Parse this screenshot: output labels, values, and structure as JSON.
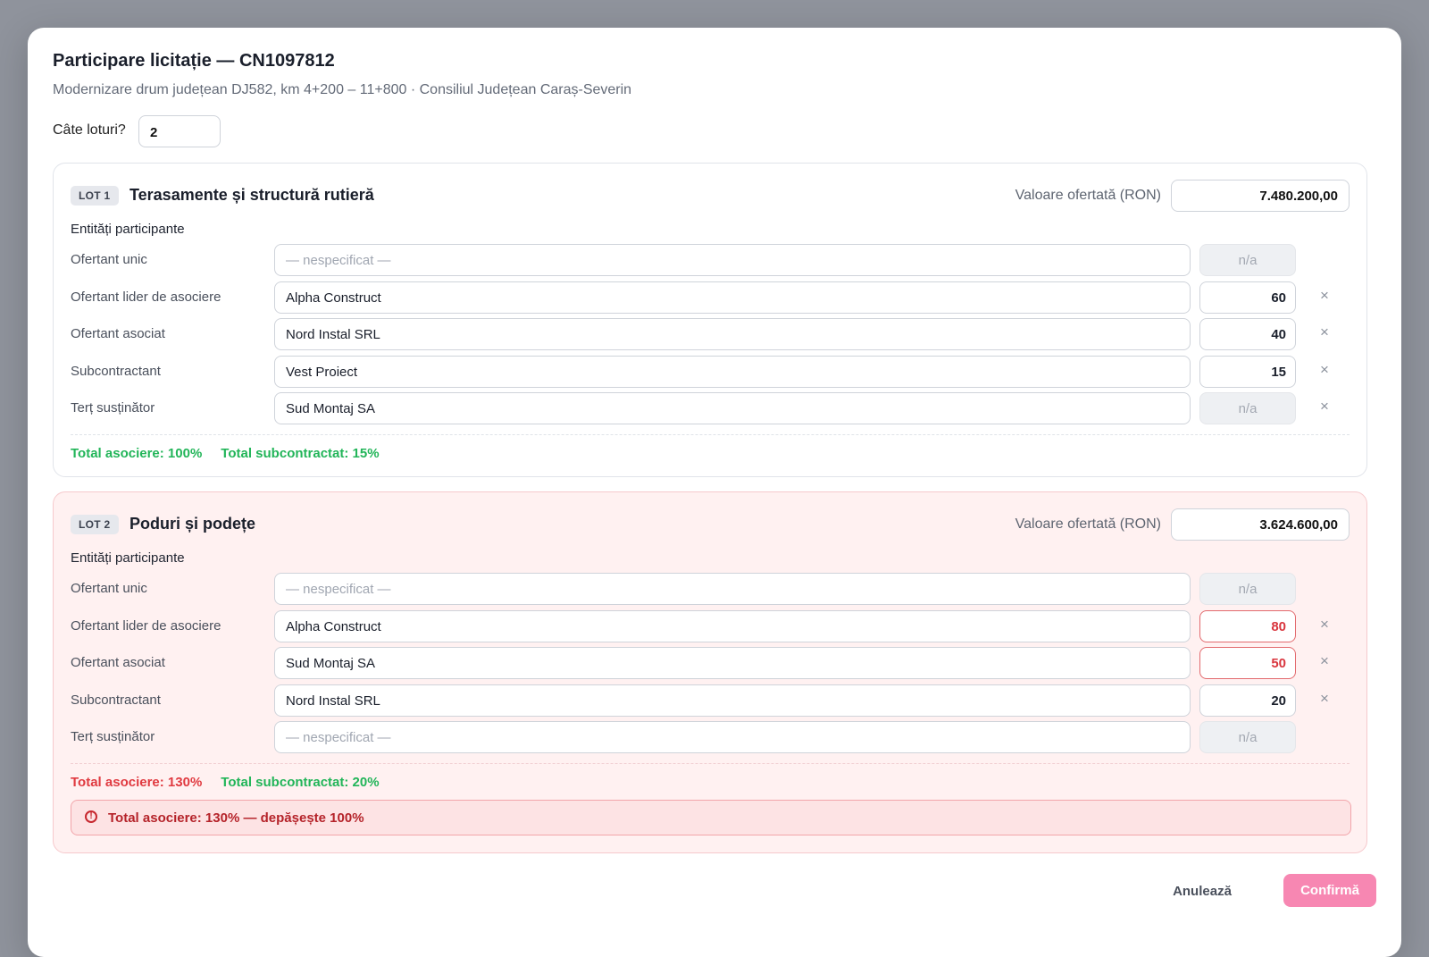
{
  "header": {
    "title": "Participare licitație — CN1097812",
    "subtitle": "Modernizare drum județean DJ582, km 4+200 – 11+800 · Consiliul Județean Caraș-Severin"
  },
  "lots_count": {
    "label": "Câte loturi?",
    "value": "2"
  },
  "lot_labels": {
    "offer_value": "Valoare ofertată (RON)",
    "entities_heading": "Entități participante",
    "remove_icon": "×"
  },
  "lots": [
    {
      "badge": "LOT 1",
      "name": "Terasamente și structură rutieră",
      "value": "7.480.200,00",
      "status": "ok",
      "rows": [
        {
          "label": "Ofertant unic",
          "entity": "— nespecificat —",
          "pct": "n/a"
        },
        {
          "label": "Ofertant lider de asociere",
          "entity": "Alpha Construct",
          "pct": "60"
        },
        {
          "label": "Ofertant asociat",
          "entity": "Nord Instal SRL",
          "pct": "40"
        },
        {
          "label": "Subcontractant",
          "entity": "Vest Proiect",
          "pct": "15"
        },
        {
          "label": "Terț susținător",
          "entity": "Sud Montaj SA",
          "pct": "n/a"
        }
      ],
      "total_association": "Total asociere: 100%",
      "total_subcontract": "Total subcontractat: 15%"
    },
    {
      "badge": "LOT 2",
      "name": "Poduri și podețe",
      "value": "3.624.600,00",
      "status": "error",
      "rows": [
        {
          "label": "Ofertant unic",
          "entity": "— nespecificat —",
          "pct": "n/a"
        },
        {
          "label": "Ofertant lider de asociere",
          "entity": "Alpha Construct",
          "pct": "80"
        },
        {
          "label": "Ofertant asociat",
          "entity": "Sud Montaj SA",
          "pct": "50"
        },
        {
          "label": "Subcontractant",
          "entity": "Nord Instal SRL",
          "pct": "20"
        },
        {
          "label": "Terț susținător",
          "entity": "— nespecificat —",
          "pct": "n/a"
        }
      ],
      "total_association": "Total asociere: 130%",
      "total_subcontract": "Total subcontractat: 20%",
      "alert": "Total asociere: 130% — depășește 100%"
    }
  ],
  "footer": {
    "cancel": "Anulează",
    "confirm": "Confirmă"
  },
  "colors": {
    "ok": "#22b559",
    "error": "#e03a40",
    "confirm": "#f787b2"
  }
}
